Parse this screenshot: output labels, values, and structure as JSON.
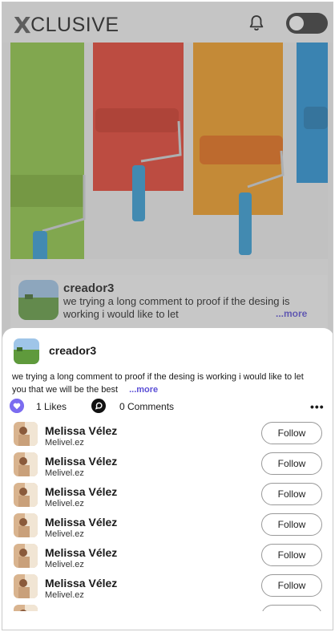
{
  "header": {
    "logo_x": "X",
    "logo_rest": "CLUSIVE",
    "bell_icon": "bell-icon",
    "toggle_state": "off"
  },
  "post": {
    "author": "creador3",
    "text": "we trying a long comment to proof if the desing is working i would like to let",
    "more": "...more"
  },
  "sheet": {
    "author": "creador3",
    "text": "we trying a long comment to proof if the desing is working i would like to let you that we will be the best",
    "more": "...more",
    "likes": "1 Likes",
    "comments": "0 Comments",
    "menu_icon": "more-dots-icon",
    "accent": "#7b6cf0"
  },
  "followers": [
    {
      "name": "Melissa Vélez",
      "username": "Melivel.ez",
      "button": "Follow"
    },
    {
      "name": "Melissa Vélez",
      "username": "Melivel.ez",
      "button": "Follow"
    },
    {
      "name": "Melissa Vélez",
      "username": "Melivel.ez",
      "button": "Follow"
    },
    {
      "name": "Melissa Vélez",
      "username": "Melivel.ez",
      "button": "Follow"
    },
    {
      "name": "Melissa Vélez",
      "username": "Melivel.ez",
      "button": "Follow"
    },
    {
      "name": "Melissa Vélez",
      "username": "Melivel.ez",
      "button": "Follow"
    },
    {
      "name": "",
      "username": "",
      "button": ""
    }
  ]
}
